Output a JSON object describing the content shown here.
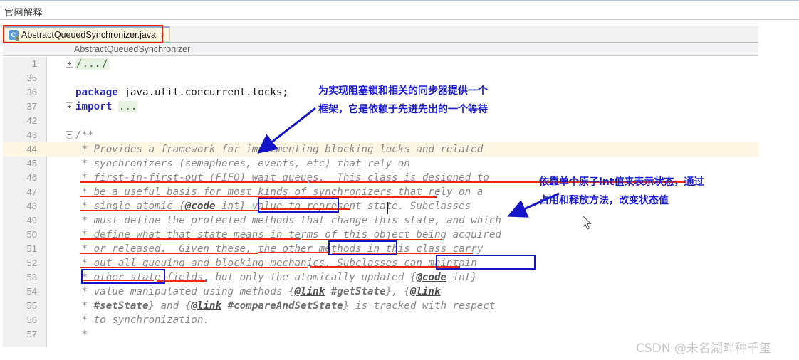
{
  "window": {
    "title": "官网解释"
  },
  "tab": {
    "label": "AbstractQueuedSynchronizer.java",
    "icon": "java-class-icon",
    "close": "×"
  },
  "breadcrumb": {
    "text": "AbstractQueuedSynchronizer"
  },
  "editor": {
    "lines": [
      {
        "num": "1",
        "fold": "plus",
        "segments": [
          {
            "t": "/...",
            "c": "fold-inline"
          },
          {
            "t": "/",
            "c": "fold-inline"
          }
        ]
      },
      {
        "num": "35",
        "fold": "",
        "segments": []
      },
      {
        "num": "36",
        "fold": "",
        "segments": [
          {
            "t": "package ",
            "c": "kw"
          },
          {
            "t": "java.util.concurrent.locks;",
            "c": "plain"
          }
        ]
      },
      {
        "num": "37",
        "fold": "plus",
        "segments": [
          {
            "t": "import ",
            "c": "kw"
          },
          {
            "t": "...",
            "c": "fold-inline"
          }
        ]
      },
      {
        "num": "42",
        "fold": "",
        "segments": []
      },
      {
        "num": "43",
        "fold": "minus",
        "segments": [
          {
            "t": "/**",
            "c": "cmt"
          }
        ]
      },
      {
        "num": "44",
        "fold": "",
        "hl": true,
        "segments": [
          {
            "t": " * Provides a framework for implementing blocking locks and related",
            "c": "cmt"
          }
        ]
      },
      {
        "num": "45",
        "fold": "",
        "segments": [
          {
            "t": " * synchronizers (semaphores, events, etc) that rely on",
            "c": "cmt"
          }
        ]
      },
      {
        "num": "46",
        "fold": "",
        "segments": [
          {
            "t": " * first-in-first-out (FIFO) wait queues.  This class is designed to",
            "c": "cmt"
          }
        ]
      },
      {
        "num": "47",
        "fold": "",
        "segments": [
          {
            "t": " * be a useful basis for most kinds of synchronizers that rely on a",
            "c": "cmt"
          }
        ]
      },
      {
        "num": "48",
        "fold": "",
        "segments": [
          {
            "t": " * single atomic {",
            "c": "cmt"
          },
          {
            "t": "@code",
            "c": "cmt-link"
          },
          {
            "t": " int} value to represent state. Subclasses",
            "c": "cmt"
          }
        ]
      },
      {
        "num": "49",
        "fold": "",
        "segments": [
          {
            "t": " * must define the protected methods that change this state, and which",
            "c": "cmt"
          }
        ]
      },
      {
        "num": "50",
        "fold": "",
        "segments": [
          {
            "t": " * define what that state means in terms of this object being acquired",
            "c": "cmt"
          }
        ]
      },
      {
        "num": "51",
        "fold": "",
        "segments": [
          {
            "t": " * or released.  Given these, the other methods in this class carry",
            "c": "cmt"
          }
        ]
      },
      {
        "num": "52",
        "fold": "",
        "segments": [
          {
            "t": " * out all queuing and blocking mechanics. Subclasses can maintain",
            "c": "cmt"
          }
        ]
      },
      {
        "num": "53",
        "fold": "",
        "segments": [
          {
            "t": " * other state fields, but only the atomically updated {",
            "c": "cmt"
          },
          {
            "t": "@code",
            "c": "cmt-link"
          },
          {
            "t": " int}",
            "c": "cmt"
          }
        ]
      },
      {
        "num": "54",
        "fold": "",
        "segments": [
          {
            "t": " * value manipulated using methods {",
            "c": "cmt"
          },
          {
            "t": "@link",
            "c": "cmt-link"
          },
          {
            "t": " ",
            "c": "cmt"
          },
          {
            "t": "#getState",
            "c": "cmt-b"
          },
          {
            "t": "}, {",
            "c": "cmt"
          },
          {
            "t": "@link",
            "c": "cmt-link"
          }
        ]
      },
      {
        "num": "55",
        "fold": "",
        "segments": [
          {
            "t": " * ",
            "c": "cmt"
          },
          {
            "t": "#setState",
            "c": "cmt-b"
          },
          {
            "t": "} and {",
            "c": "cmt"
          },
          {
            "t": "@link",
            "c": "cmt-link"
          },
          {
            "t": " ",
            "c": "cmt"
          },
          {
            "t": "#compareAndSetState",
            "c": "cmt-b"
          },
          {
            "t": "} is tracked with respect",
            "c": "cmt"
          }
        ]
      },
      {
        "num": "56",
        "fold": "",
        "segments": [
          {
            "t": " * to synchronization.",
            "c": "cmt"
          }
        ]
      },
      {
        "num": "57",
        "fold": "",
        "segments": [
          {
            "t": " *",
            "c": "cmt"
          }
        ]
      }
    ]
  },
  "annotations": {
    "note_top": {
      "line1": "为实现阻塞锁和相关的同步器提供一个",
      "line2": "框架，它是依赖于先进先出的一个等待"
    },
    "note_right": {
      "line1": "依靠单个原子int值来表示状态，通过",
      "line2": "占用和释放方法，改变状态值"
    }
  },
  "colors": {
    "annotation_red": "#e82c0c",
    "annotation_blue": "#1414c8",
    "note_blue": "#1a1ad2",
    "highlight_line": "#fdf6e3"
  },
  "watermark": {
    "text": "CSDN @未名湖畔种千玺"
  }
}
